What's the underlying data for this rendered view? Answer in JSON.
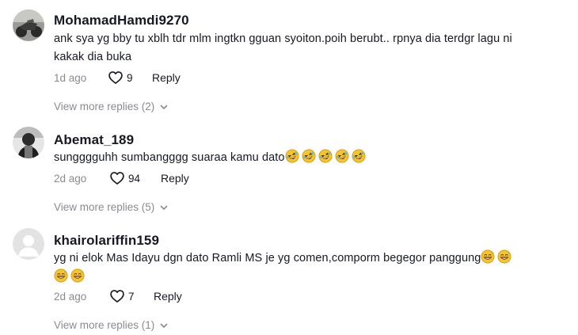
{
  "comments": [
    {
      "username": "MohamadHamdi9270",
      "text_lines": [
        "ank sya yg bby tu xblh tdr mlm ingtkn gguan syoiton.poih berubt.. rpnya dia terdgr lagu ni",
        "kakak dia buka"
      ],
      "time": "1d ago",
      "likes": "9",
      "reply_label": "Reply",
      "view_more": "View more replies (2)",
      "avatar": "motorcycle-photo"
    },
    {
      "username": "Abemat_189",
      "text": "sungggguhh sumbangggg suaraa kamu dato",
      "emojis": [
        "rofl",
        "rofl",
        "rofl",
        "rofl",
        "rofl"
      ],
      "time": "2d ago",
      "likes": "94",
      "reply_label": "Reply",
      "view_more": "View more replies (5)",
      "avatar": "person-photo"
    },
    {
      "username": "khairolariffin159",
      "text": "yg ni elok Mas Idayu dgn dato Ramli MS je yg comen,comporm begegor panggung",
      "emojis_line1": [
        "grin-sweat",
        "grin-sweat"
      ],
      "emojis_line2": [
        "grin-sweat",
        "grin-sweat"
      ],
      "time": "2d ago",
      "likes": "7",
      "reply_label": "Reply",
      "view_more": "View more replies (1)",
      "avatar": "default-avatar"
    }
  ],
  "colors": {
    "text": "#161823",
    "muted": "#8a8b91",
    "emoji_face": "#f7c52b"
  }
}
